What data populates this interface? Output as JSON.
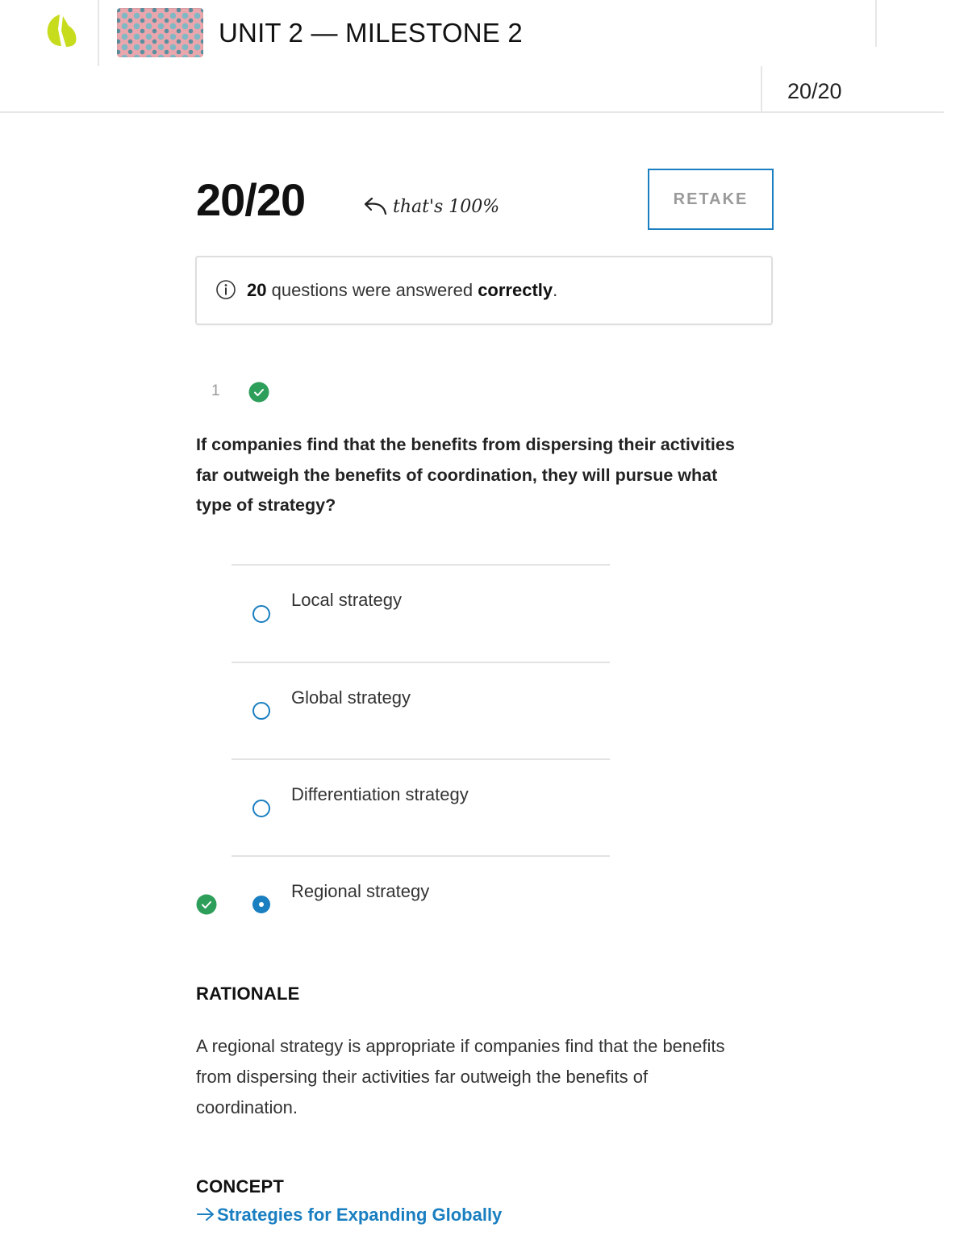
{
  "header": {
    "title": "UNIT 2 — MILESTONE 2",
    "score": "20/20"
  },
  "result": {
    "score": "20/20",
    "note": "that's 100%",
    "retake_label": "RETAKE",
    "info_count": "20",
    "info_middle": " questions were answered ",
    "info_correct": "correctly",
    "info_end": "."
  },
  "question": {
    "number": "1",
    "text": "If companies find that the benefits from dispersing their activities far outweigh the benefits of coordination, they will pursue what type of strategy?",
    "options": [
      {
        "label": "Local strategy",
        "selected": false
      },
      {
        "label": "Global strategy",
        "selected": false
      },
      {
        "label": "Differentiation strategy",
        "selected": false
      },
      {
        "label": "Regional strategy",
        "selected": true,
        "correct": true
      }
    ]
  },
  "rationale": {
    "title": "RATIONALE",
    "text": "A regional strategy is appropriate if companies find that the benefits from dispersing their activities far outweigh the benefits of coordination."
  },
  "concept": {
    "title": "CONCEPT",
    "link_label": "Strategies for Expanding Globally"
  },
  "colors": {
    "accent_blue": "#1a7fc1",
    "success_green": "#2e9e5b",
    "logo_lime": "#c8dc1e"
  },
  "icons": {
    "logo": "sophia-logo-icon",
    "info": "info-circle-icon",
    "check": "check-circle-icon",
    "note_arrow": "curved-arrow-icon",
    "link_arrow": "arrow-right-icon"
  }
}
